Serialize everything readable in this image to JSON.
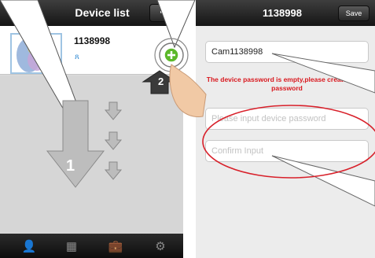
{
  "left_screen": {
    "title": "Device list",
    "add_button": "+",
    "device": {
      "name": "1138998",
      "user_icon": "person-outline-icon"
    },
    "tabs": [
      {
        "icon": "person-icon",
        "glyph": "👤",
        "active": true
      },
      {
        "icon": "grid-icon",
        "glyph": "▦",
        "active": false
      },
      {
        "icon": "briefcase-icon",
        "glyph": "💼",
        "active": false
      },
      {
        "icon": "gear-icon",
        "glyph": "⚙",
        "active": false
      }
    ]
  },
  "right_screen": {
    "title": "1138998",
    "save_button": "Save",
    "name_field_value": "Cam1138998",
    "warning_text": "The device password is empty,please create a new password",
    "password_placeholder": "Please input device password",
    "confirm_placeholder": "Confirm Input"
  },
  "steps": {
    "step1": "1",
    "step2": "2"
  },
  "colors": {
    "navbar": "#1f1f1f",
    "tab_active": "#3a98e0",
    "warning": "#d9181e",
    "highlight_ellipse": "#d8202a",
    "add_circle": "#5cb82a"
  }
}
